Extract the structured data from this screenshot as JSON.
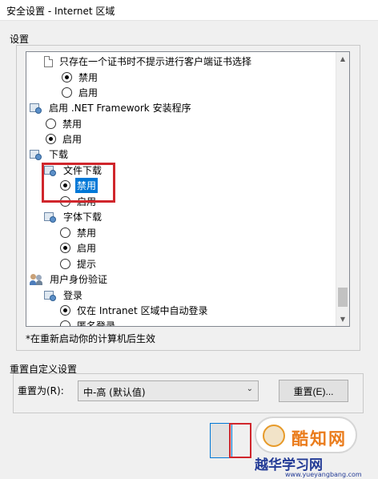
{
  "window": {
    "title": "安全设置 - Internet 区域"
  },
  "settings_group": {
    "label": "设置"
  },
  "tree": {
    "rows": [
      {
        "kind": "header",
        "icon": "document-icon",
        "text": "只存在一个证书时不提示进行客户端证书选择"
      },
      {
        "kind": "radio",
        "checked": true,
        "text": "禁用"
      },
      {
        "kind": "radio",
        "checked": false,
        "text": "启用"
      },
      {
        "kind": "header",
        "icon": "settings-gear-icon",
        "text": "启用 .NET Framework 安装程序"
      },
      {
        "kind": "radio",
        "checked": false,
        "text": "禁用"
      },
      {
        "kind": "radio",
        "checked": true,
        "text": "启用"
      },
      {
        "kind": "header",
        "icon": "settings-gear-icon",
        "text": "下载"
      },
      {
        "kind": "subheader",
        "icon": "settings-gear-icon",
        "text": "文件下载"
      },
      {
        "kind": "radio",
        "checked": true,
        "text": "禁用",
        "selected": true
      },
      {
        "kind": "radio",
        "checked": false,
        "text": "启用"
      },
      {
        "kind": "subheader",
        "icon": "settings-gear-icon",
        "text": "字体下载"
      },
      {
        "kind": "radio",
        "checked": false,
        "text": "禁用"
      },
      {
        "kind": "radio",
        "checked": true,
        "text": "启用"
      },
      {
        "kind": "radio",
        "checked": false,
        "text": "提示"
      },
      {
        "kind": "header",
        "icon": "users-icon",
        "text": "用户身份验证"
      },
      {
        "kind": "subheader",
        "icon": "settings-gear-icon",
        "text": "登录"
      },
      {
        "kind": "radio",
        "checked": true,
        "text": "仅在 Intranet 区域中自动登录"
      },
      {
        "kind": "radio",
        "checked": false,
        "text": "匿名登录"
      }
    ]
  },
  "note": "*在重新启动你的计算机后生效",
  "reset_group": {
    "label": "重置自定义设置"
  },
  "reset": {
    "label": "重置为(R):",
    "selected": "中-高 (默认值)",
    "button": "重置(E)..."
  },
  "watermark": {
    "logo_text": "酷知网",
    "site_cn": "越华学习网",
    "site_en": "www.yueyangbang.com"
  },
  "colors": {
    "selection": "#0078d7",
    "highlight": "#d0262c",
    "watermark_orange": "#ea7c1c",
    "watermark_blue": "#233b96"
  }
}
